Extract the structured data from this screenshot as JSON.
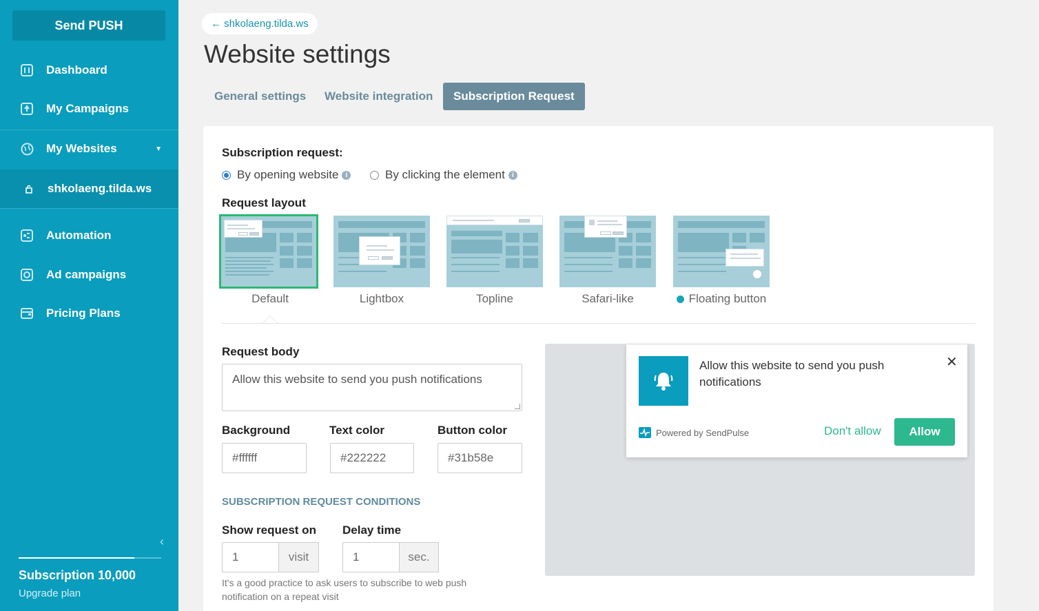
{
  "sidebar": {
    "send_button": "Send PUSH",
    "items": [
      {
        "label": "Dashboard",
        "icon": "dashboard-icon"
      },
      {
        "label": "My Campaigns",
        "icon": "campaigns-icon"
      },
      {
        "label": "My Websites",
        "icon": "globe-icon"
      },
      {
        "label": "shkolaeng.tilda.ws",
        "icon": "lock-icon"
      },
      {
        "label": "Automation",
        "icon": "automation-icon"
      },
      {
        "label": "Ad campaigns",
        "icon": "ad-icon"
      },
      {
        "label": "Pricing Plans",
        "icon": "wallet-icon"
      }
    ],
    "subscription": "Subscription 10,000",
    "subscription_used_fraction": 0.81,
    "upgrade": "Upgrade plan"
  },
  "header": {
    "back_link": "← shkolaeng.tilda.ws",
    "title": "Website settings",
    "tabs": [
      "General settings",
      "Website integration",
      "Subscription Request"
    ],
    "active_tab": "Subscription Request"
  },
  "form": {
    "subscription_request_label": "Subscription request:",
    "radio_options": [
      "By opening website",
      "By clicking the element"
    ],
    "selected_radio": "By opening website",
    "layout_label": "Request layout",
    "layouts": [
      "Default",
      "Lightbox",
      "Topline",
      "Safari-like",
      "Floating button"
    ],
    "selected_layout": "Default",
    "body_label": "Request body",
    "body_value": "Allow this website to send you push notifications",
    "background_label": "Background",
    "background_value": "#ffffff",
    "text_color_label": "Text color",
    "text_color_value": "#222222",
    "button_color_label": "Button color",
    "button_color_value": "#31b58e",
    "conditions_heading": "SUBSCRIPTION REQUEST CONDITIONS",
    "show_on_label": "Show request on",
    "show_on_value": "1",
    "show_on_unit": "visit",
    "delay_label": "Delay time",
    "delay_value": "1",
    "delay_unit": "sec.",
    "hint": "It's a good practice to ask users to subscribe to web push notification on a repeat visit"
  },
  "preview": {
    "message": "Allow this website to send you push notifications",
    "powered_by": "Powered by SendPulse",
    "deny": "Don't allow",
    "allow": "Allow"
  },
  "colors": {
    "sidebar": "#0a9dbd",
    "accent_green": "#2db88f",
    "tab_active": "#6a8b9b"
  }
}
